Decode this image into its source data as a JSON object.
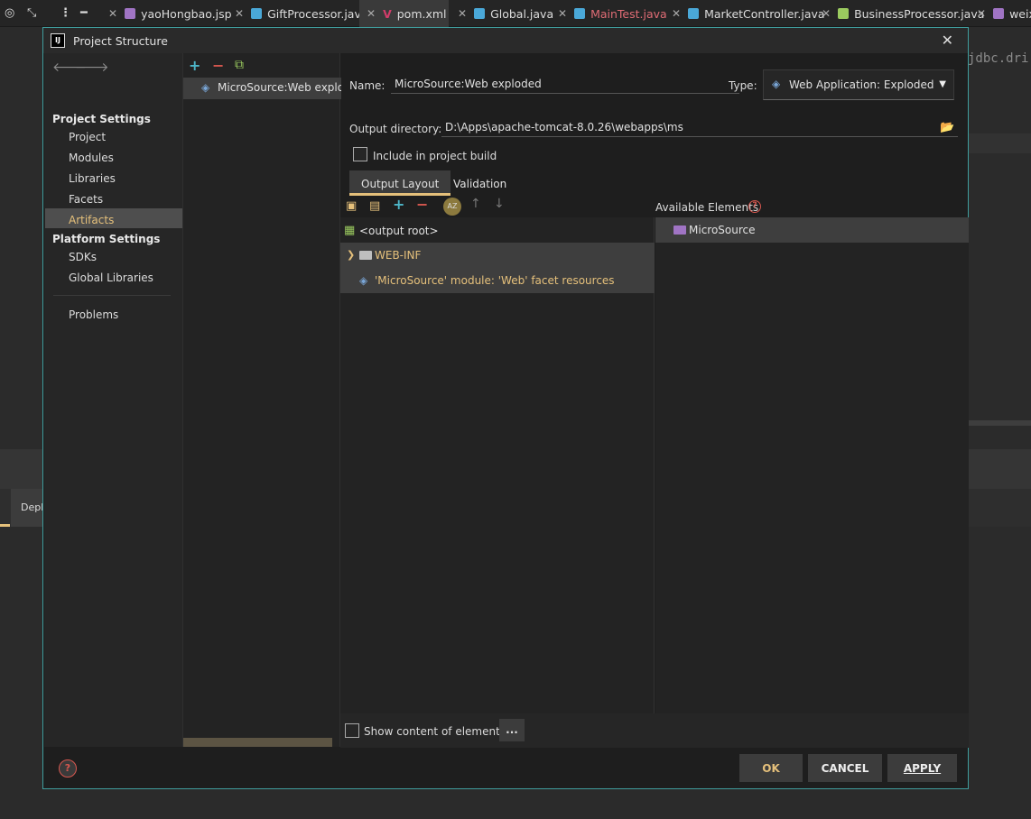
{
  "editor_tabs": [
    {
      "label": "yaoHongbao.jsp",
      "icon": "jsp-file-icon",
      "error": false
    },
    {
      "label": "GiftProcessor.java",
      "icon": "java-class-icon",
      "error": false
    },
    {
      "label": "pom.xml",
      "icon": "maven-icon",
      "error": false,
      "active": true
    },
    {
      "label": "Global.java",
      "icon": "java-class-icon",
      "error": false
    },
    {
      "label": "MainTest.java",
      "icon": "java-class-icon",
      "error": true
    },
    {
      "label": "MarketController.java",
      "icon": "java-class-icon",
      "error": false
    },
    {
      "label": "BusinessProcessor.java",
      "icon": "java-class-icon",
      "error": false
    },
    {
      "label": "weix",
      "icon": "jsp-file-icon",
      "error": false
    }
  ],
  "editor": {
    "code_fragment": "jdbc.dri",
    "bottom_tab": "Depl"
  },
  "dialog": {
    "title": "Project Structure",
    "logo": "IJ",
    "nav": {
      "project_settings": "Project Settings",
      "items": [
        "Project",
        "Modules",
        "Libraries",
        "Facets",
        "Artifacts"
      ],
      "selected": "Artifacts",
      "platform_settings": "Platform Settings",
      "platform_items": [
        "SDKs",
        "Global Libraries"
      ],
      "problems": "Problems"
    },
    "artifact": {
      "list_item": "MicroSource:Web exploded"
    },
    "form": {
      "name_label": "Name:",
      "name_value": "MicroSource:Web exploded",
      "type_label": "Type:",
      "type_value": "Web Application: Exploded",
      "output_dir_label": "Output directory:",
      "output_dir_value": "D:\\Apps\\apache-tomcat-8.0.26\\webapps\\ms",
      "include_label": "Include in project build",
      "include_checked": false
    },
    "tabs": [
      {
        "label": "Output Layout",
        "active": true
      },
      {
        "label": "Validation",
        "active": false
      }
    ],
    "layout_tree": {
      "root": "<output root>",
      "items": [
        "WEB-INF",
        "'MicroSource' module: 'Web' facet resources"
      ]
    },
    "available": {
      "label": "Available Elements",
      "items": [
        "MicroSource"
      ]
    },
    "show_content_label": "Show content of elements",
    "more_button": "...",
    "buttons": {
      "ok": "OK",
      "cancel": "CANCEL",
      "apply": "APPLY"
    },
    "colors": {
      "accent": "#e5c07b",
      "border": "#3f9d9d",
      "error": "#d7574f",
      "add": "#4db6c8"
    }
  }
}
